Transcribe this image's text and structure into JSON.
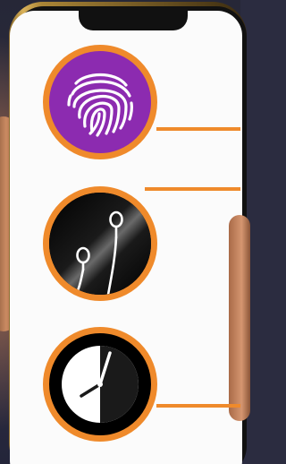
{
  "colors": {
    "accent": "#ef8a2b",
    "fingerprint_bg": "#8c2bb0",
    "screen": "#fbfbfb",
    "frame_gold": "#d9b25a",
    "background": "#2b2c40"
  },
  "icons": [
    {
      "name": "fingerprint-icon"
    },
    {
      "name": "earphones-icon"
    },
    {
      "name": "clock-icon"
    }
  ]
}
